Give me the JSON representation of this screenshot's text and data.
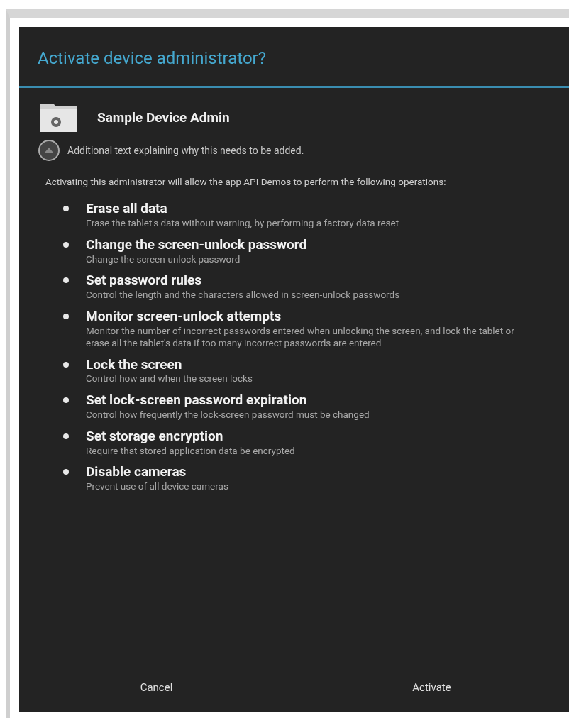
{
  "dialog": {
    "title": "Activate device administrator?",
    "app": {
      "name": "Sample Device Admin"
    },
    "hint": "Additional text explaining why this needs to be added.",
    "intro": "Activating this administrator will allow the app API Demos to perform the following operations:",
    "policies": [
      {
        "title": "Erase all data",
        "description": "Erase the tablet's data without warning, by performing a factory data reset"
      },
      {
        "title": "Change the screen-unlock password",
        "description": "Change the screen-unlock password"
      },
      {
        "title": "Set password rules",
        "description": "Control the length and the characters allowed in screen-unlock passwords"
      },
      {
        "title": "Monitor screen-unlock attempts",
        "description": "Monitor the number of incorrect passwords entered when unlocking the screen, and lock the tablet or erase all the tablet's data if too many incorrect passwords are entered"
      },
      {
        "title": "Lock the screen",
        "description": "Control how and when the screen locks"
      },
      {
        "title": "Set lock-screen password expiration",
        "description": "Control how frequently the lock-screen password must be changed"
      },
      {
        "title": "Set storage encryption",
        "description": "Require that stored application data be encrypted"
      },
      {
        "title": "Disable cameras",
        "description": "Prevent use of all device cameras"
      }
    ],
    "buttons": [
      "Cancel",
      "Activate"
    ]
  }
}
